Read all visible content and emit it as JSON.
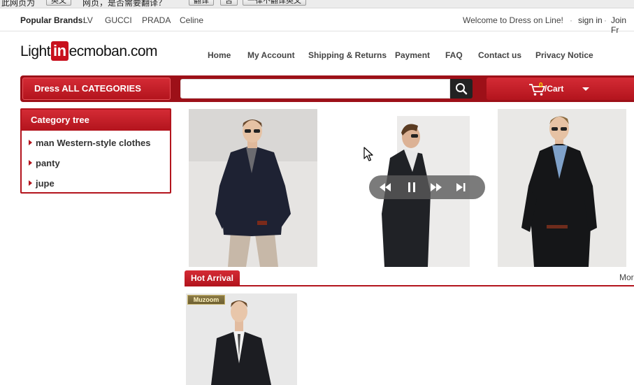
{
  "translate_bar": {
    "text_left": "此网页为",
    "lang_select": "英文",
    "text_mid": "网页，是否需要翻译？",
    "translate_button": "翻译",
    "no_button": "否",
    "never_button": "一律不翻译英文"
  },
  "topbar": {
    "popular_label": "Popular Brands:",
    "brands": [
      "LV",
      "GUCCI",
      "PRADA",
      "Celine"
    ],
    "welcome": "Welcome to Dress on Line!",
    "sign_in": "sign in",
    "join": "Join Fr"
  },
  "logo": {
    "part1": "Light",
    "part2": "in",
    "part3": "ecmoban.com"
  },
  "nav": [
    "Home",
    "My Account",
    "Shipping & Returns",
    "Payment",
    "FAQ",
    "Contact us",
    "Privacy Notice"
  ],
  "category_bar": {
    "all_categories": "Dress ALL CATEGORIES",
    "search_value": "",
    "search_placeholder": "",
    "cart_count": "0",
    "cart_label": "/Cart"
  },
  "category_tree": {
    "title": "Category tree",
    "items": [
      "man Western-style clothes",
      "panty",
      "jupe"
    ]
  },
  "slider": {
    "controls": [
      "prev",
      "pause",
      "next",
      "last"
    ]
  },
  "hot_arrival": {
    "title": "Hot Arrival",
    "more": "More",
    "badge": "Muzoom"
  },
  "colors": {
    "brand_red": "#b3141d",
    "dark_red": "#9d1018",
    "search_button": "#222222"
  }
}
